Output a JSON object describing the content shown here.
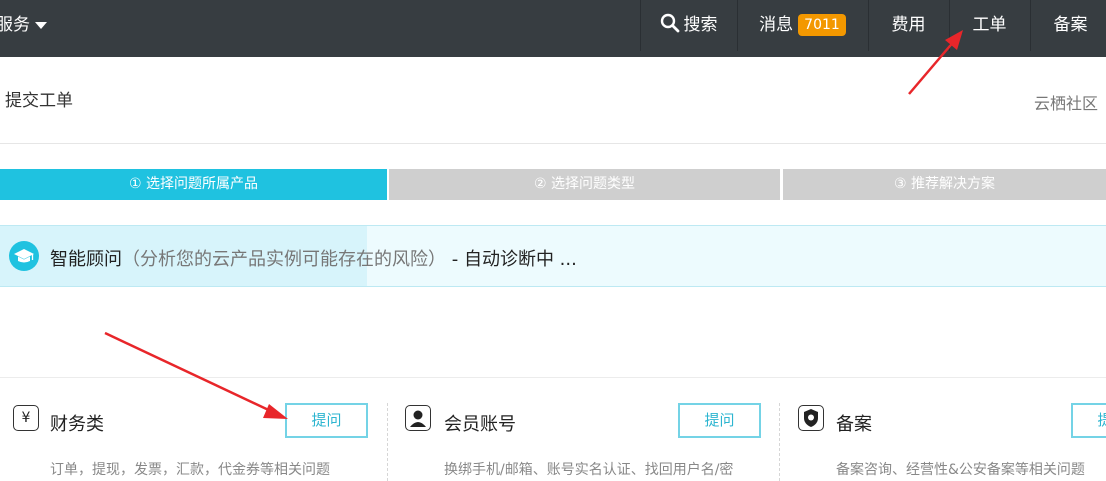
{
  "topbar": {
    "service_label": "服务",
    "search_label": "搜索",
    "messages_label": "消息",
    "messages_count": "7011",
    "fees_label": "费用",
    "tickets_label": "工单",
    "filing_label": "备案"
  },
  "page": {
    "title": "提交工单",
    "community_link": "云栖社区"
  },
  "steps": [
    {
      "label": "① 选择问题所属产品",
      "active": true
    },
    {
      "label": "② 选择问题类型",
      "active": false
    },
    {
      "label": "③ 推荐解决方案",
      "active": false
    }
  ],
  "advisor": {
    "name": "智能顾问",
    "description": "（分析您的云产品实例可能存在的风险）",
    "status": " - 自动诊断中 ..."
  },
  "categories": [
    {
      "icon": "yen-icon",
      "name": "财务类",
      "ask_label": "提问",
      "desc": "订单，提现，发票，汇款，代金券等相关问题"
    },
    {
      "icon": "user-icon",
      "name": "会员账号",
      "ask_label": "提问",
      "desc": "换绑手机/邮箱、账号实名认证、找回用户名/密"
    },
    {
      "icon": "shield-icon",
      "name": "备案",
      "ask_label": "提问",
      "desc": "备案咨询、经营性&公安备案等相关问题"
    }
  ],
  "colors": {
    "topbar": "#373d41",
    "accent": "#1fc2e0",
    "badge": "#f39800",
    "annotation_arrow": "#e8262a"
  }
}
